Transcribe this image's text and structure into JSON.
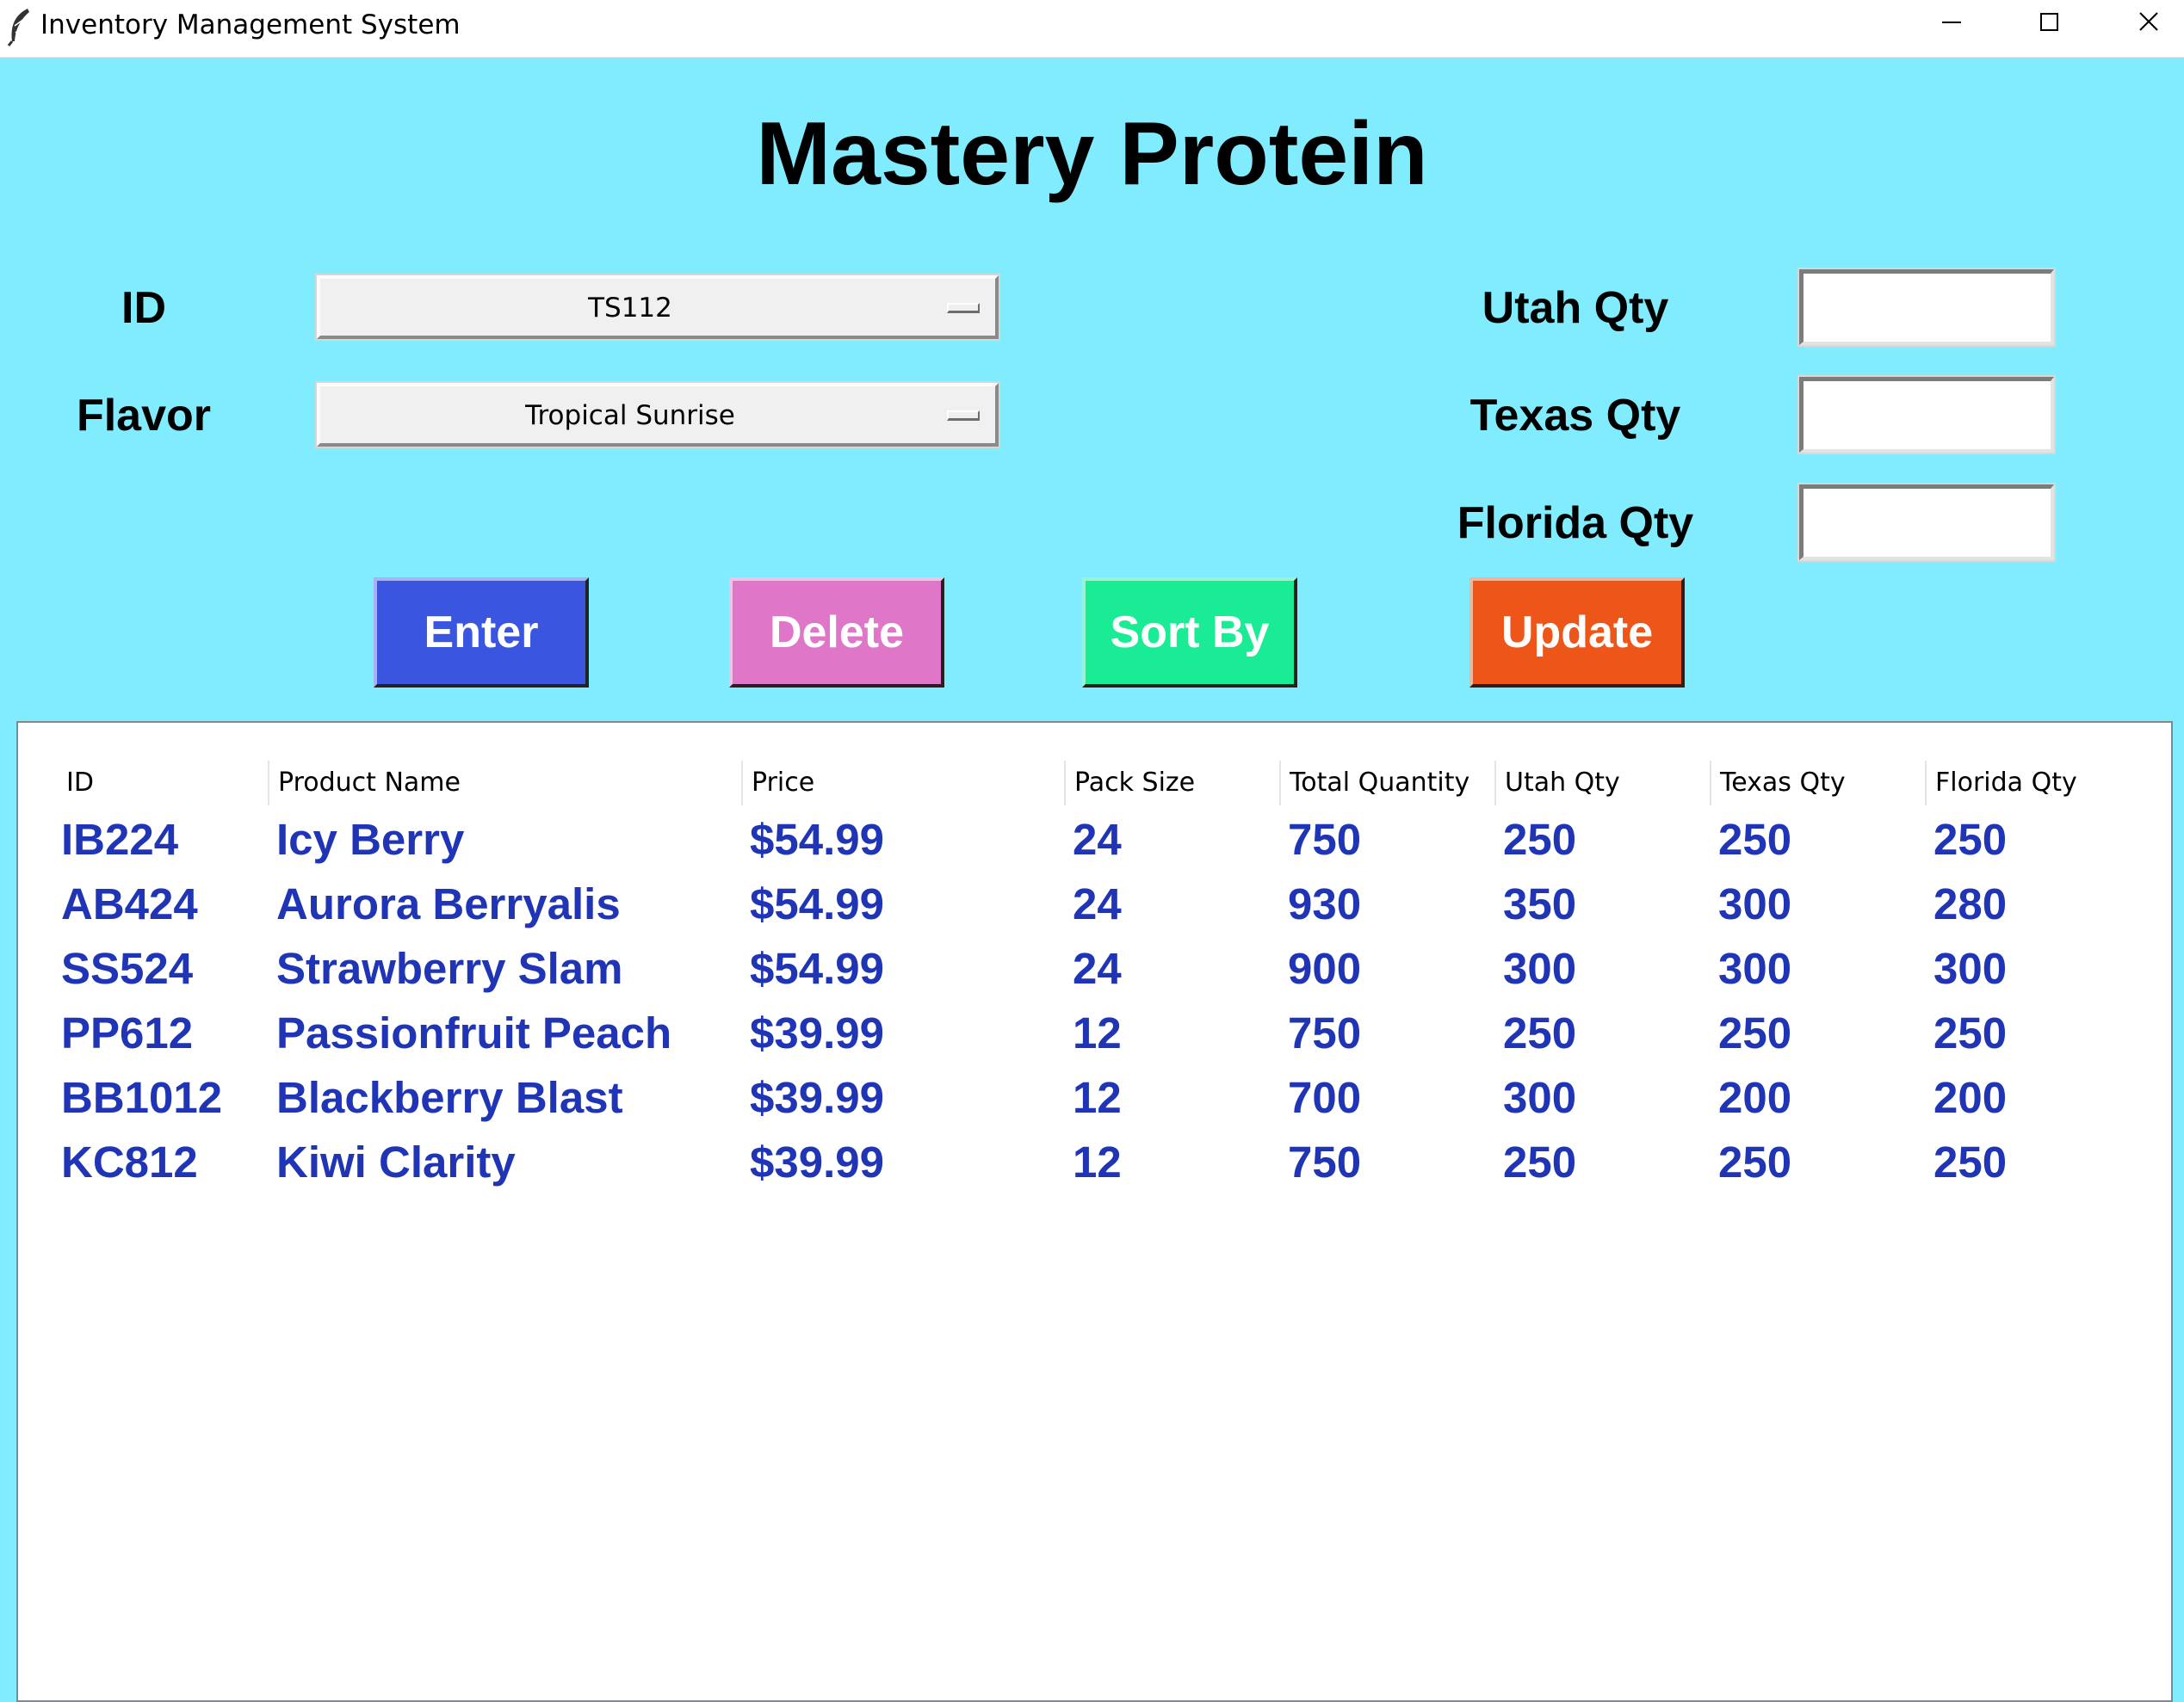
{
  "window": {
    "title": "Inventory Management System",
    "icon": "feather-icon"
  },
  "heading": "Mastery Protein",
  "form": {
    "id_label": "ID",
    "id_value": "TS112",
    "flavor_label": "Flavor",
    "flavor_value": "Tropical Sunrise",
    "utah_label": "Utah Qty",
    "utah_value": "",
    "texas_label": "Texas Qty",
    "texas_value": "",
    "florida_label": "Florida Qty",
    "florida_value": ""
  },
  "buttons": {
    "enter": {
      "label": "Enter",
      "color": "#3a55e0"
    },
    "delete": {
      "label": "Delete",
      "color": "#e076c8"
    },
    "sort": {
      "label": "Sort By",
      "color": "#19ec94"
    },
    "update": {
      "label": "Update",
      "color": "#ee5519"
    }
  },
  "colors": {
    "background": "#80ecfe",
    "row_text": "#1f35b5"
  },
  "table": {
    "columns": [
      "ID",
      "Product Name",
      "Price",
      "Pack Size",
      "Total Quantity",
      "Utah Qty",
      "Texas Qty",
      "Florida Qty"
    ],
    "rows": [
      [
        "IB224",
        "Icy Berry",
        "$54.99",
        "24",
        "750",
        "250",
        "250",
        "250"
      ],
      [
        "AB424",
        "Aurora Berryalis",
        "$54.99",
        "24",
        "930",
        "350",
        "300",
        "280"
      ],
      [
        "SS524",
        "Strawberry Slam",
        "$54.99",
        "24",
        "900",
        "300",
        "300",
        "300"
      ],
      [
        "PP612",
        "Passionfruit Peach",
        "$39.99",
        "12",
        "750",
        "250",
        "250",
        "250"
      ],
      [
        "BB1012",
        "Blackberry Blast",
        "$39.99",
        "12",
        "700",
        "300",
        "200",
        "200"
      ],
      [
        "KC812",
        "Kiwi Clarity",
        "$39.99",
        "12",
        "750",
        "250",
        "250",
        "250"
      ]
    ]
  }
}
